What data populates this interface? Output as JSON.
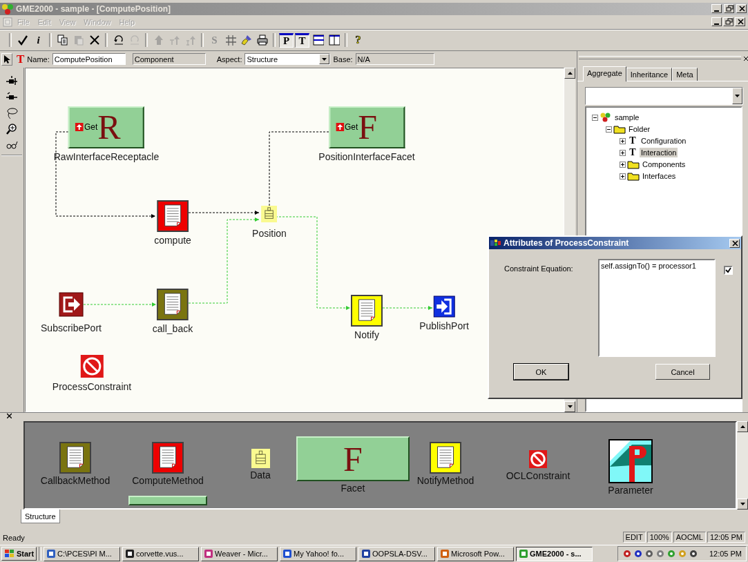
{
  "window": {
    "title": "GME2000 - sample - [ComputePosition]"
  },
  "menu": [
    {
      "label": "File",
      "disabled": true
    },
    {
      "label": "Edit",
      "disabled": true
    },
    {
      "label": "View",
      "disabled": true
    },
    {
      "label": "Window",
      "disabled": true
    },
    {
      "label": "Help",
      "disabled": true
    }
  ],
  "toolbar": [
    [
      {
        "kind": "check",
        "disabled": false,
        "pressed": false
      },
      {
        "kind": "info",
        "glyph": "i",
        "disabled": false,
        "pressed": false
      }
    ],
    [
      {
        "kind": "copy",
        "disabled": false,
        "pressed": false
      },
      {
        "kind": "paste",
        "disabled": true,
        "pressed": false
      },
      {
        "kind": "delete",
        "disabled": false,
        "pressed": false
      }
    ],
    [
      {
        "kind": "undo",
        "disabled": false,
        "pressed": false
      },
      {
        "kind": "redo",
        "disabled": true,
        "pressed": false
      }
    ],
    [
      {
        "kind": "up",
        "disabled": true,
        "pressed": false
      },
      {
        "kind": "tup",
        "disabled": true,
        "pressed": false
      },
      {
        "kind": "iup",
        "disabled": true,
        "pressed": false
      }
    ],
    [
      {
        "kind": "letter",
        "glyph": "S",
        "disabled": true,
        "pressed": false
      },
      {
        "kind": "grid",
        "disabled": false,
        "pressed": false
      },
      {
        "kind": "brush",
        "disabled": false,
        "pressed": false
      },
      {
        "kind": "print",
        "disabled": false,
        "pressed": false
      }
    ],
    [
      {
        "kind": "letter",
        "glyph": "P",
        "disabled": false,
        "pressed": true
      },
      {
        "kind": "letter",
        "glyph": "T",
        "disabled": false,
        "pressed": true
      },
      {
        "kind": "hsplit",
        "disabled": false,
        "pressed": false
      },
      {
        "kind": "vsplit",
        "disabled": false,
        "pressed": false
      }
    ],
    [
      {
        "kind": "help",
        "glyph": "?",
        "disabled": false,
        "pressed": false
      }
    ]
  ],
  "attributes": {
    "type_glyph": "T",
    "name_label": "Name:",
    "name": "ComputePosition",
    "kind_value": "Component",
    "aspect_label": "Aspect:",
    "aspect": "Structure",
    "base_label": "Base:",
    "base": "N/A"
  },
  "tools": [
    {
      "kind": "connect"
    },
    {
      "kind": "disconnect"
    },
    {
      "kind": "lasso"
    },
    {
      "kind": "zoom"
    },
    {
      "kind": "visualize"
    }
  ],
  "diagram": {
    "nodes": [
      {
        "kind": "receptacle",
        "label": "RawInterfaceReceptacle",
        "letter": "R",
        "port": "Get"
      },
      {
        "kind": "facet",
        "label": "PositionInterfaceFacet",
        "letter": "F",
        "port": "Get"
      },
      {
        "kind": "compute",
        "label": "compute"
      },
      {
        "kind": "data",
        "label": "Position"
      },
      {
        "kind": "subscribe",
        "label": "SubscribePort"
      },
      {
        "kind": "callback",
        "label": "call_back"
      },
      {
        "kind": "notify",
        "label": "Notify"
      },
      {
        "kind": "publish",
        "label": "PublishPort"
      },
      {
        "kind": "constraint",
        "label": "ProcessConstraint"
      }
    ],
    "edges": [
      {
        "color": "#000000"
      },
      {
        "color": "#000000"
      },
      {
        "color": "#000000"
      },
      {
        "color": "#33cc33"
      },
      {
        "color": "#33cc33"
      },
      {
        "color": "#33cc33"
      },
      {
        "color": "#33cc33"
      }
    ]
  },
  "browser": {
    "tabs": [
      {
        "label": "Aggregate",
        "selected": true
      },
      {
        "label": "Inheritance",
        "selected": false
      },
      {
        "label": "Meta",
        "selected": false
      }
    ],
    "tree": [
      {
        "label": "sample",
        "kind": "project",
        "expanded": true,
        "selected": false,
        "children": [
          {
            "label": "Folder",
            "kind": "folder",
            "expanded": true,
            "selected": false,
            "children": [
              {
                "label": "Configuration",
                "kind": "model",
                "glyph": "T",
                "expanded": false,
                "selected": false
              },
              {
                "label": "Interaction",
                "kind": "model",
                "glyph": "T",
                "expanded": false,
                "selected": true
              },
              {
                "label": "Components",
                "kind": "folder",
                "expanded": false,
                "selected": false
              },
              {
                "label": "Interfaces",
                "kind": "folder",
                "expanded": false,
                "selected": false
              }
            ]
          }
        ]
      }
    ]
  },
  "dialog": {
    "title": "Attributes of ProcessConstraint",
    "field_label": "Constraint Equation:",
    "value": "self.assignTo() = processor1",
    "checked": true,
    "buttons": [
      {
        "label": "OK",
        "default": true
      },
      {
        "label": "Cancel",
        "default": false
      }
    ]
  },
  "parts": [
    {
      "kind": "callback",
      "label": "CallbackMethod"
    },
    {
      "kind": "compute",
      "label": "ComputeMethod"
    },
    {
      "kind": "data",
      "label": "Data"
    },
    {
      "kind": "facet",
      "label": "Facet",
      "letter": "F"
    },
    {
      "kind": "notify",
      "label": "NotifyMethod"
    },
    {
      "kind": "constraint",
      "label": "OCLConstraint"
    },
    {
      "kind": "parameter",
      "label": "Parameter"
    }
  ],
  "aspect_tabs": [
    {
      "label": "Structure",
      "selected": true
    }
  ],
  "status_bar": {
    "message": "Ready",
    "panes": [
      "EDIT",
      "100%",
      "AOCML",
      "12:05 PM"
    ]
  },
  "taskbar": {
    "start": "Start",
    "tasks": [
      {
        "label": "C:\\PCES\\PI M...",
        "selected": false
      },
      {
        "label": "corvette.vus...",
        "selected": false
      },
      {
        "label": "Weaver - Micr...",
        "selected": false
      },
      {
        "label": "My Yahoo! fo...",
        "selected": false
      },
      {
        "label": "OOPSLA-DSV...",
        "selected": false
      },
      {
        "label": "Microsoft Pow...",
        "selected": false
      },
      {
        "label": "GME2000 - s...",
        "selected": true
      }
    ],
    "clock": "12:05 PM"
  }
}
